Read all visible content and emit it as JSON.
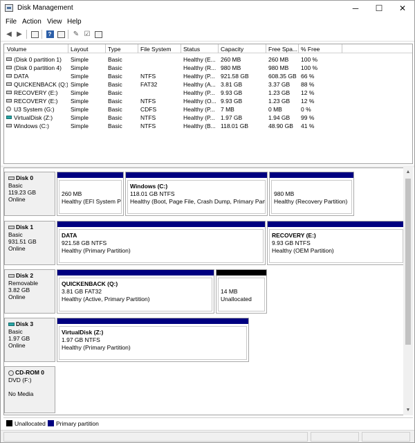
{
  "window": {
    "title": "Disk Management",
    "minimize": "─",
    "maximize": "☐",
    "close": "✕"
  },
  "menu": [
    "File",
    "Action",
    "View",
    "Help"
  ],
  "toolbar_icons": [
    "back-icon",
    "forward-icon",
    "console-tree-icon",
    "help-icon",
    "properties-icon",
    "action-icon",
    "check-icon",
    "list-icon"
  ],
  "volume_table": {
    "headers": [
      "Volume",
      "Layout",
      "Type",
      "File System",
      "Status",
      "Capacity",
      "Free Spa...",
      "% Free"
    ],
    "rows": [
      {
        "icon": "disk",
        "volume": "(Disk 0 partition 1)",
        "layout": "Simple",
        "type": "Basic",
        "fs": "",
        "status": "Healthy (E...",
        "capacity": "260 MB",
        "free": "260 MB",
        "pct": "100 %"
      },
      {
        "icon": "disk",
        "volume": "(Disk 0 partition 4)",
        "layout": "Simple",
        "type": "Basic",
        "fs": "",
        "status": "Healthy (R...",
        "capacity": "980 MB",
        "free": "980 MB",
        "pct": "100 %"
      },
      {
        "icon": "disk",
        "volume": "DATA",
        "layout": "Simple",
        "type": "Basic",
        "fs": "NTFS",
        "status": "Healthy (P...",
        "capacity": "921.58 GB",
        "free": "608.35 GB",
        "pct": "66 %"
      },
      {
        "icon": "disk",
        "volume": "QUICKENBACK (Q:)",
        "layout": "Simple",
        "type": "Basic",
        "fs": "FAT32",
        "status": "Healthy (A...",
        "capacity": "3.81 GB",
        "free": "3.37 GB",
        "pct": "88 %"
      },
      {
        "icon": "disk",
        "volume": "RECOVERY (E:)",
        "layout": "Simple",
        "type": "Basic",
        "fs": "",
        "status": "Healthy (P...",
        "capacity": "9.93 GB",
        "free": "1.23 GB",
        "pct": "12 %"
      },
      {
        "icon": "disk",
        "volume": "RECOVERY (E:)",
        "layout": "Simple",
        "type": "Basic",
        "fs": "NTFS",
        "status": "Healthy (O...",
        "capacity": "9.93 GB",
        "free": "1.23 GB",
        "pct": "12 %"
      },
      {
        "icon": "cd",
        "volume": "U3 System (G:)",
        "layout": "Simple",
        "type": "Basic",
        "fs": "CDFS",
        "status": "Healthy (P...",
        "capacity": "7 MB",
        "free": "0 MB",
        "pct": "0 %"
      },
      {
        "icon": "teal",
        "volume": "VirtualDisk (Z:)",
        "layout": "Simple",
        "type": "Basic",
        "fs": "NTFS",
        "status": "Healthy (P...",
        "capacity": "1.97 GB",
        "free": "1.94 GB",
        "pct": "99 %"
      },
      {
        "icon": "disk",
        "volume": "Windows (C:)",
        "layout": "Simple",
        "type": "Basic",
        "fs": "NTFS",
        "status": "Healthy (B...",
        "capacity": "118.01 GB",
        "free": "48.90 GB",
        "pct": "41 %"
      }
    ]
  },
  "disks": [
    {
      "name": "Disk 0",
      "icon": "disk",
      "lines": [
        "Basic",
        "119.23 GB",
        "Online"
      ],
      "partitions": [
        {
          "bar": "primary",
          "name": "",
          "lines": [
            "260 MB",
            "Healthy (EFI System Par"
          ]
        },
        {
          "bar": "primary",
          "name": "Windows  (C:)",
          "lines": [
            "118.01 GB NTFS",
            "Healthy (Boot, Page File, Crash Dump, Primary Partit"
          ]
        },
        {
          "bar": "primary",
          "name": "",
          "lines": [
            "980 MB",
            "Healthy (Recovery Partition)"
          ]
        }
      ]
    },
    {
      "name": "Disk 1",
      "icon": "disk",
      "lines": [
        "Basic",
        "931.51 GB",
        "Online"
      ],
      "partitions": [
        {
          "bar": "primary",
          "name": "DATA",
          "lines": [
            "921.58 GB NTFS",
            "Healthy (Primary Partition)"
          ]
        },
        {
          "bar": "primary",
          "name": "RECOVERY  (E:)",
          "lines": [
            "9.93 GB NTFS",
            "Healthy (OEM Partition)"
          ]
        }
      ]
    },
    {
      "name": "Disk 2",
      "icon": "disk",
      "lines": [
        "Removable",
        "3.82 GB",
        "Online"
      ],
      "partitions": [
        {
          "bar": "primary",
          "name": "QUICKENBACK  (Q:)",
          "lines": [
            "3.81 GB FAT32",
            "Healthy (Active, Primary Partition)"
          ]
        },
        {
          "bar": "unallocated",
          "name": "",
          "lines": [
            "14 MB",
            "Unallocated"
          ]
        }
      ]
    },
    {
      "name": "Disk 3",
      "icon": "teal",
      "lines": [
        "Basic",
        "1.97 GB",
        "Online"
      ],
      "partitions": [
        {
          "bar": "primary",
          "name": "VirtualDisk  (Z:)",
          "lines": [
            "1.97 GB NTFS",
            "Healthy (Primary Partition)"
          ]
        }
      ]
    },
    {
      "name": "CD-ROM 0",
      "icon": "cd",
      "lines": [
        "DVD (F:)",
        "",
        "No Media"
      ],
      "partitions": []
    }
  ],
  "legend": [
    {
      "label": "Unallocated",
      "color": "#000000"
    },
    {
      "label": "Primary partition",
      "color": "#000080"
    }
  ],
  "colors": {
    "primary": "#000080",
    "unallocated": "#000000",
    "teal_disk": "#2aa6a6"
  }
}
